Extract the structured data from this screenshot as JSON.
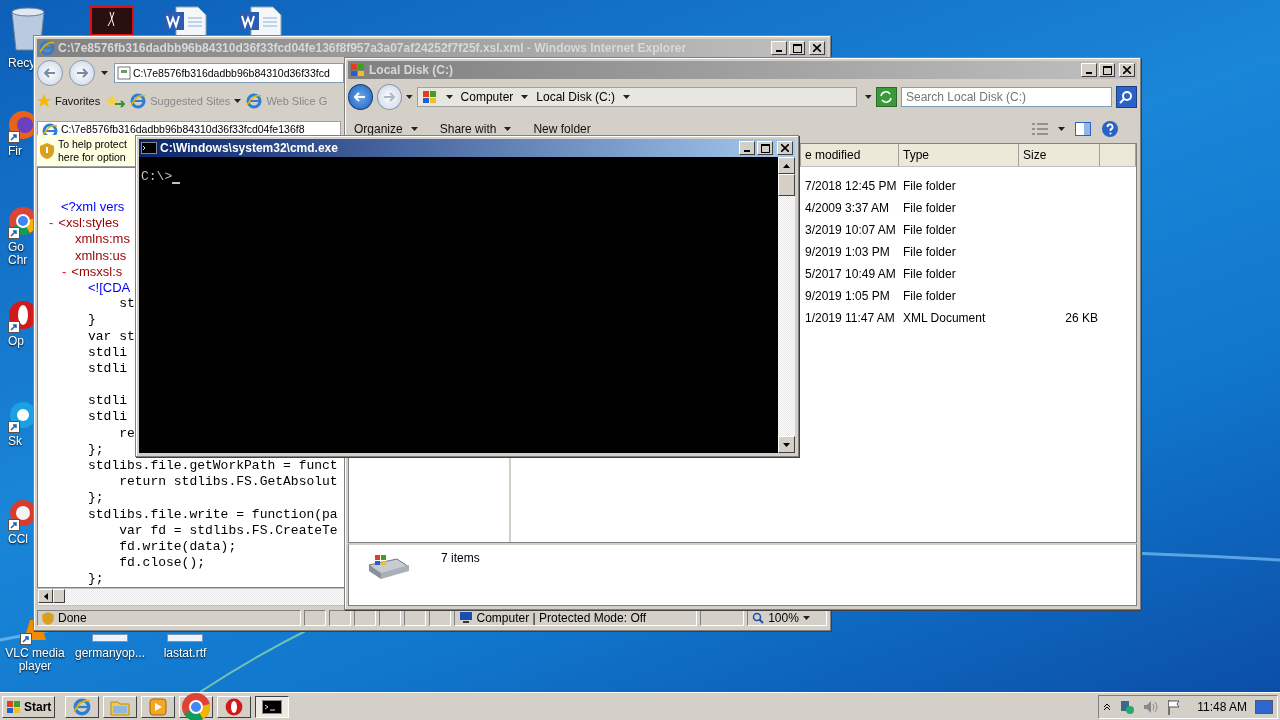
{
  "desktop_icons": [
    {
      "kind": "recycle",
      "label": "Recy"
    },
    {
      "kind": "firefox",
      "label": "Fir"
    },
    {
      "kind": "chrome",
      "label": "Go Chr"
    },
    {
      "kind": "opera",
      "label": "Op"
    },
    {
      "kind": "skype",
      "label": "Sk"
    },
    {
      "kind": "ccleaner",
      "label": "CCl"
    },
    {
      "kind": "vlc",
      "label": "VLC media player"
    },
    {
      "kind": "doc",
      "label": "germanyop..."
    },
    {
      "kind": "doc",
      "label": "lastat.rtf"
    },
    {
      "kind": "pdf"
    },
    {
      "kind": "word"
    },
    {
      "kind": "word"
    }
  ],
  "ie_window": {
    "title": "C:\\7e8576fb316dadbb96b84310d36f33fcd04fe136f8f957a3a07af24252f7f25f.xsl.xml - Windows Internet Explorer",
    "address": "C:\\7e8576fb316dadbb96b84310d36f33fcd",
    "favorites_label": "Favorites",
    "favorites": [
      "Suggested Sites",
      "Web Slice G"
    ],
    "tab": "C:\\7e8576fb316dadbb96b84310d36f33fcd04fe136f8",
    "info_bar": [
      "To help protect",
      "here for option"
    ],
    "lines": [
      {
        "kind": "declaration",
        "text": "<?xml vers"
      },
      {
        "kind": "element",
        "toggle": "-",
        "text": "<xsl:styles"
      },
      {
        "kind": "attribute",
        "text": "xmlns:ms"
      },
      {
        "kind": "attribute",
        "text": "xmlns:us"
      },
      {
        "kind": "child_element",
        "toggle": "-",
        "text": "<msxsl:s"
      },
      {
        "kind": "cdata",
        "text": "<![CDA"
      },
      {
        "kind": "code",
        "text": "    st"
      },
      {
        "kind": "code",
        "text": "}"
      },
      {
        "kind": "code",
        "text": "var st"
      },
      {
        "kind": "code",
        "text": "stdli"
      },
      {
        "kind": "code",
        "text": "stdli"
      },
      {
        "kind": "code",
        "text": "stdli",
        "blank_before": true
      },
      {
        "kind": "code",
        "text": "stdli"
      },
      {
        "kind": "code",
        "text": "    re"
      },
      {
        "kind": "code",
        "text": "};"
      },
      {
        "kind": "code",
        "text": "stdlibs.file.getWorkPath = funct"
      },
      {
        "kind": "code",
        "text": "    return stdlibs.FS.GetAbsolut"
      },
      {
        "kind": "code",
        "text": "};"
      },
      {
        "kind": "code",
        "text": "stdlibs.file.write = function(pa"
      },
      {
        "kind": "code",
        "text": "    var fd = stdlibs.FS.CreateTe"
      },
      {
        "kind": "code",
        "text": "    fd.write(data);"
      },
      {
        "kind": "code",
        "text": "    fd.close();"
      },
      {
        "kind": "code",
        "text": "};"
      }
    ],
    "status": "Done",
    "zone": "Computer | Protected Mode: Off",
    "zoom": "100%"
  },
  "explorer_window": {
    "title": "Local Disk (C:)",
    "breadcrumb": [
      "Computer",
      "Local Disk (C:)"
    ],
    "search": {
      "placeholder": "Search Local Disk (C:)"
    },
    "toolbar": [
      {
        "label": "Organize",
        "dropdown": true
      },
      {
        "label": "Share with",
        "dropdown": true
      },
      {
        "label": "New folder",
        "dropdown": false
      }
    ],
    "columns": [
      "e modified",
      "Type",
      "Size"
    ],
    "rows": [
      {
        "date": "7/2018 12:45 PM",
        "type": "File folder"
      },
      {
        "date": "4/2009 3:37 AM",
        "type": "File folder"
      },
      {
        "date": "3/2019 10:07 AM",
        "type": "File folder"
      },
      {
        "date": "9/2019 1:03 PM",
        "type": "File folder"
      },
      {
        "date": "5/2017 10:49 AM",
        "type": "File folder"
      },
      {
        "date": "9/2019 1:05 PM",
        "type": "File folder"
      },
      {
        "date": "1/2019 11:47 AM",
        "type": "XML Document",
        "size": "26 KB"
      }
    ],
    "item_count": "7 items"
  },
  "cmd_window": {
    "title": "C:\\Windows\\system32\\cmd.exe",
    "prompt": "C:\\>"
  },
  "taskbar": {
    "start": "Start",
    "apps": [
      {
        "kind": "ie",
        "selected": false
      },
      {
        "kind": "explorer",
        "selected": false
      },
      {
        "kind": "media",
        "selected": false
      },
      {
        "kind": "chrome",
        "selected": false
      },
      {
        "kind": "opera",
        "selected": false
      },
      {
        "kind": "cmd",
        "selected": true
      }
    ],
    "clock": "11:48 AM"
  }
}
